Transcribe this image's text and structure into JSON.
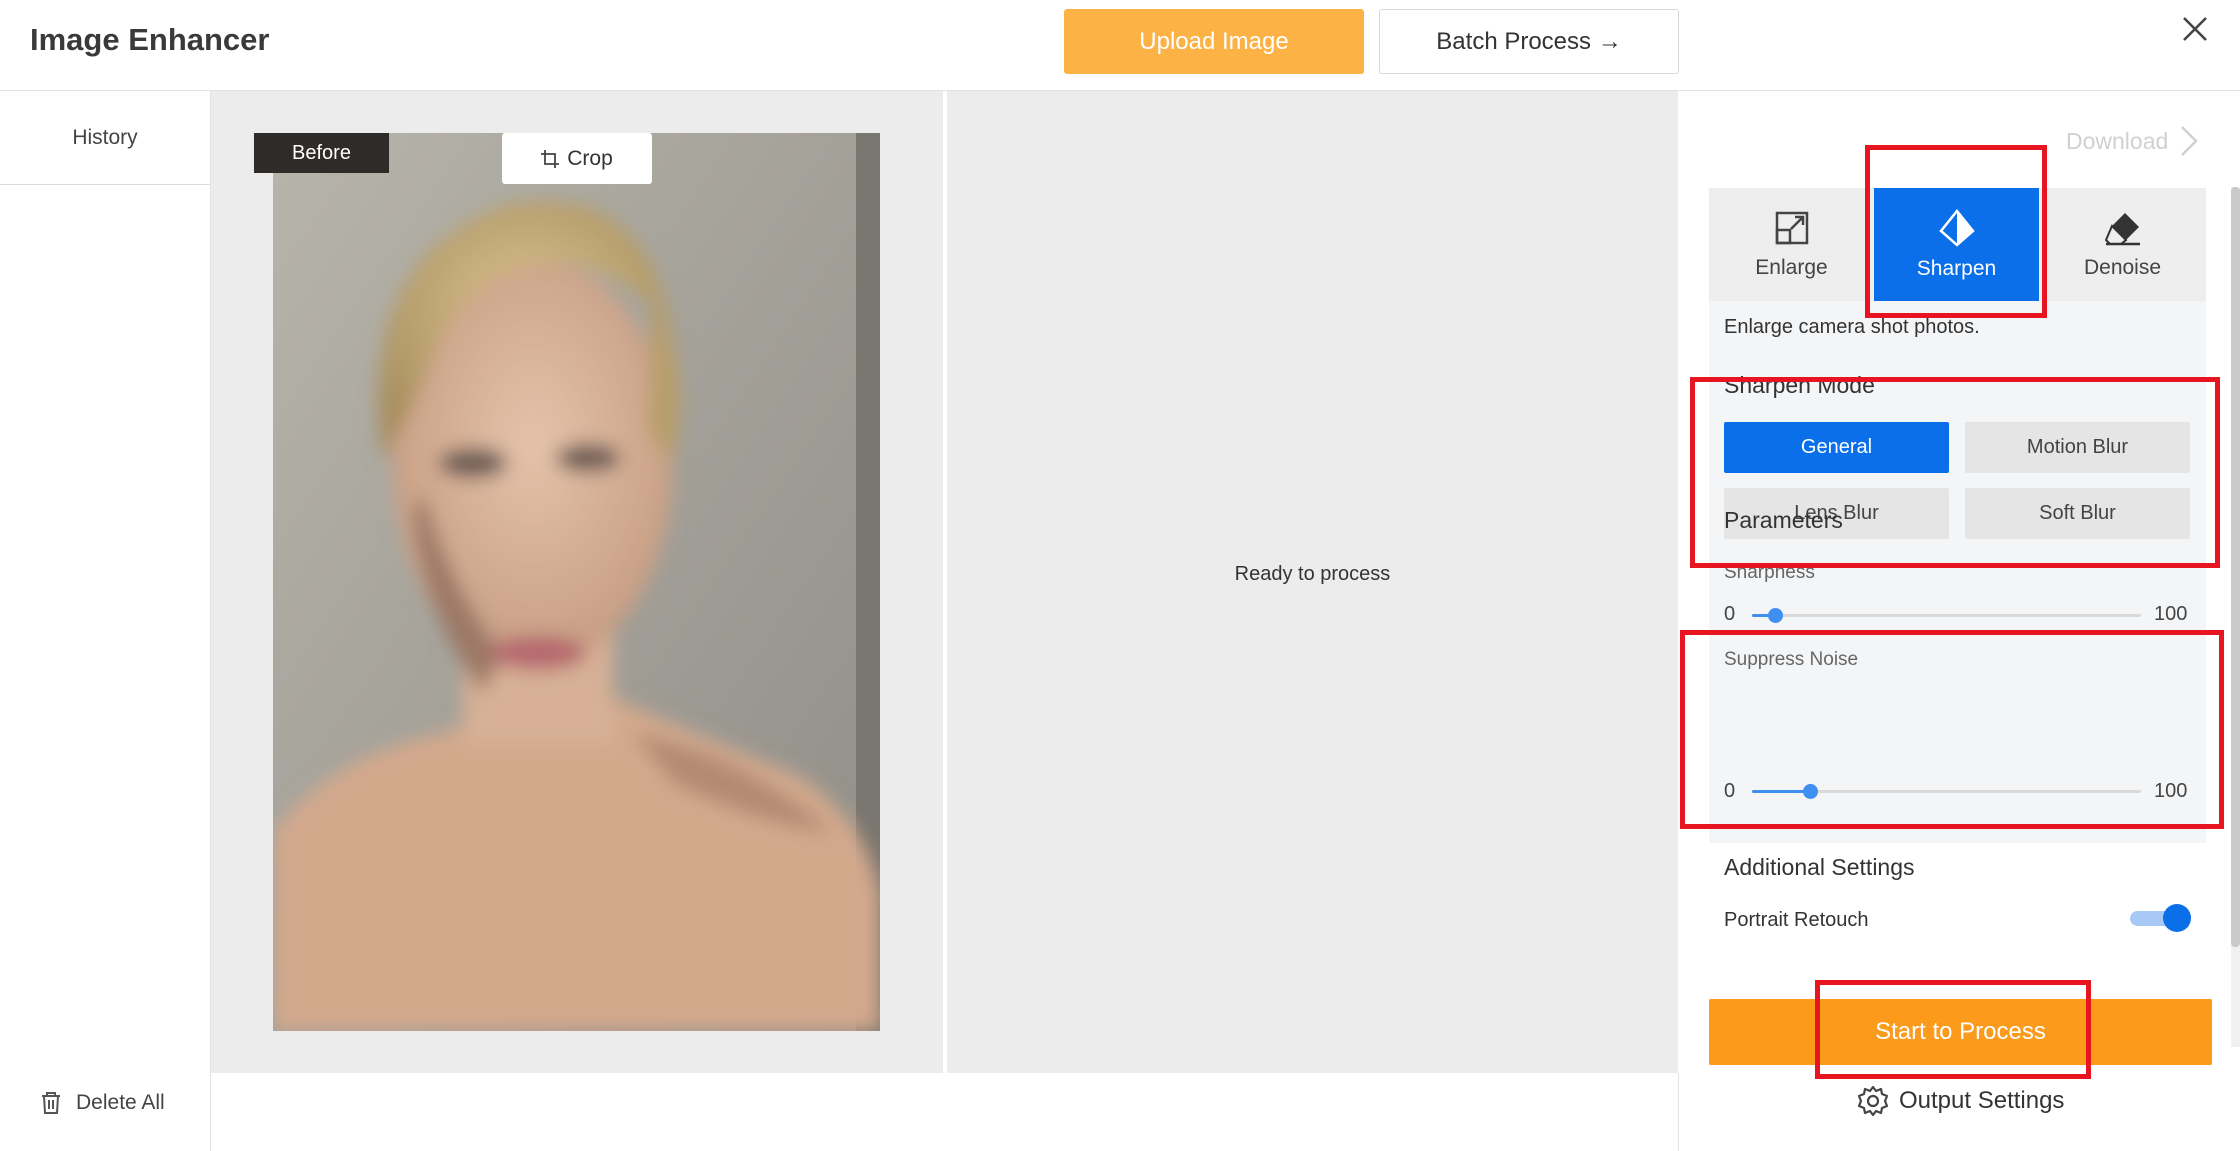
{
  "header": {
    "title": "Image Enhancer",
    "upload_label": "Upload Image",
    "batch_label": "Batch Process →"
  },
  "sidebar": {
    "history_label": "History",
    "delete_all_label": "Delete All"
  },
  "workspace": {
    "before_label": "Before",
    "crop_label": "Crop",
    "ready_text": "Ready to process"
  },
  "panel": {
    "download_label": "Download",
    "tabs": [
      {
        "label": "Enlarge",
        "icon": "enlarge-icon",
        "active": false
      },
      {
        "label": "Sharpen",
        "icon": "sharpen-icon",
        "active": true
      },
      {
        "label": "Denoise",
        "icon": "eraser-icon",
        "active": false
      }
    ],
    "description": "Enlarge camera shot photos.",
    "sharpen_mode": {
      "title": "Sharpen Mode",
      "options": [
        {
          "label": "General",
          "active": true
        },
        {
          "label": "Motion Blur",
          "active": false
        },
        {
          "label": "Lens Blur",
          "active": false
        },
        {
          "label": "Soft Blur",
          "active": false
        }
      ]
    },
    "parameters": {
      "title": "Parameters",
      "sharpness": {
        "label": "Sharpness",
        "min": "0",
        "max": "100",
        "value": 6
      },
      "suppress_noise": {
        "label": "Suppress Noise",
        "min": "0",
        "max": "100",
        "value": 15
      }
    },
    "additional": {
      "title": "Additional Settings",
      "portrait_retouch": {
        "label": "Portrait Retouch",
        "enabled": true
      }
    },
    "start_label": "Start to Process",
    "output_settings_label": "Output Settings"
  },
  "colors": {
    "accent_blue": "#0a6fe8",
    "upload_orange": "#fdb246",
    "start_orange": "#fb9a1b",
    "annotation_red": "#e8141f"
  }
}
